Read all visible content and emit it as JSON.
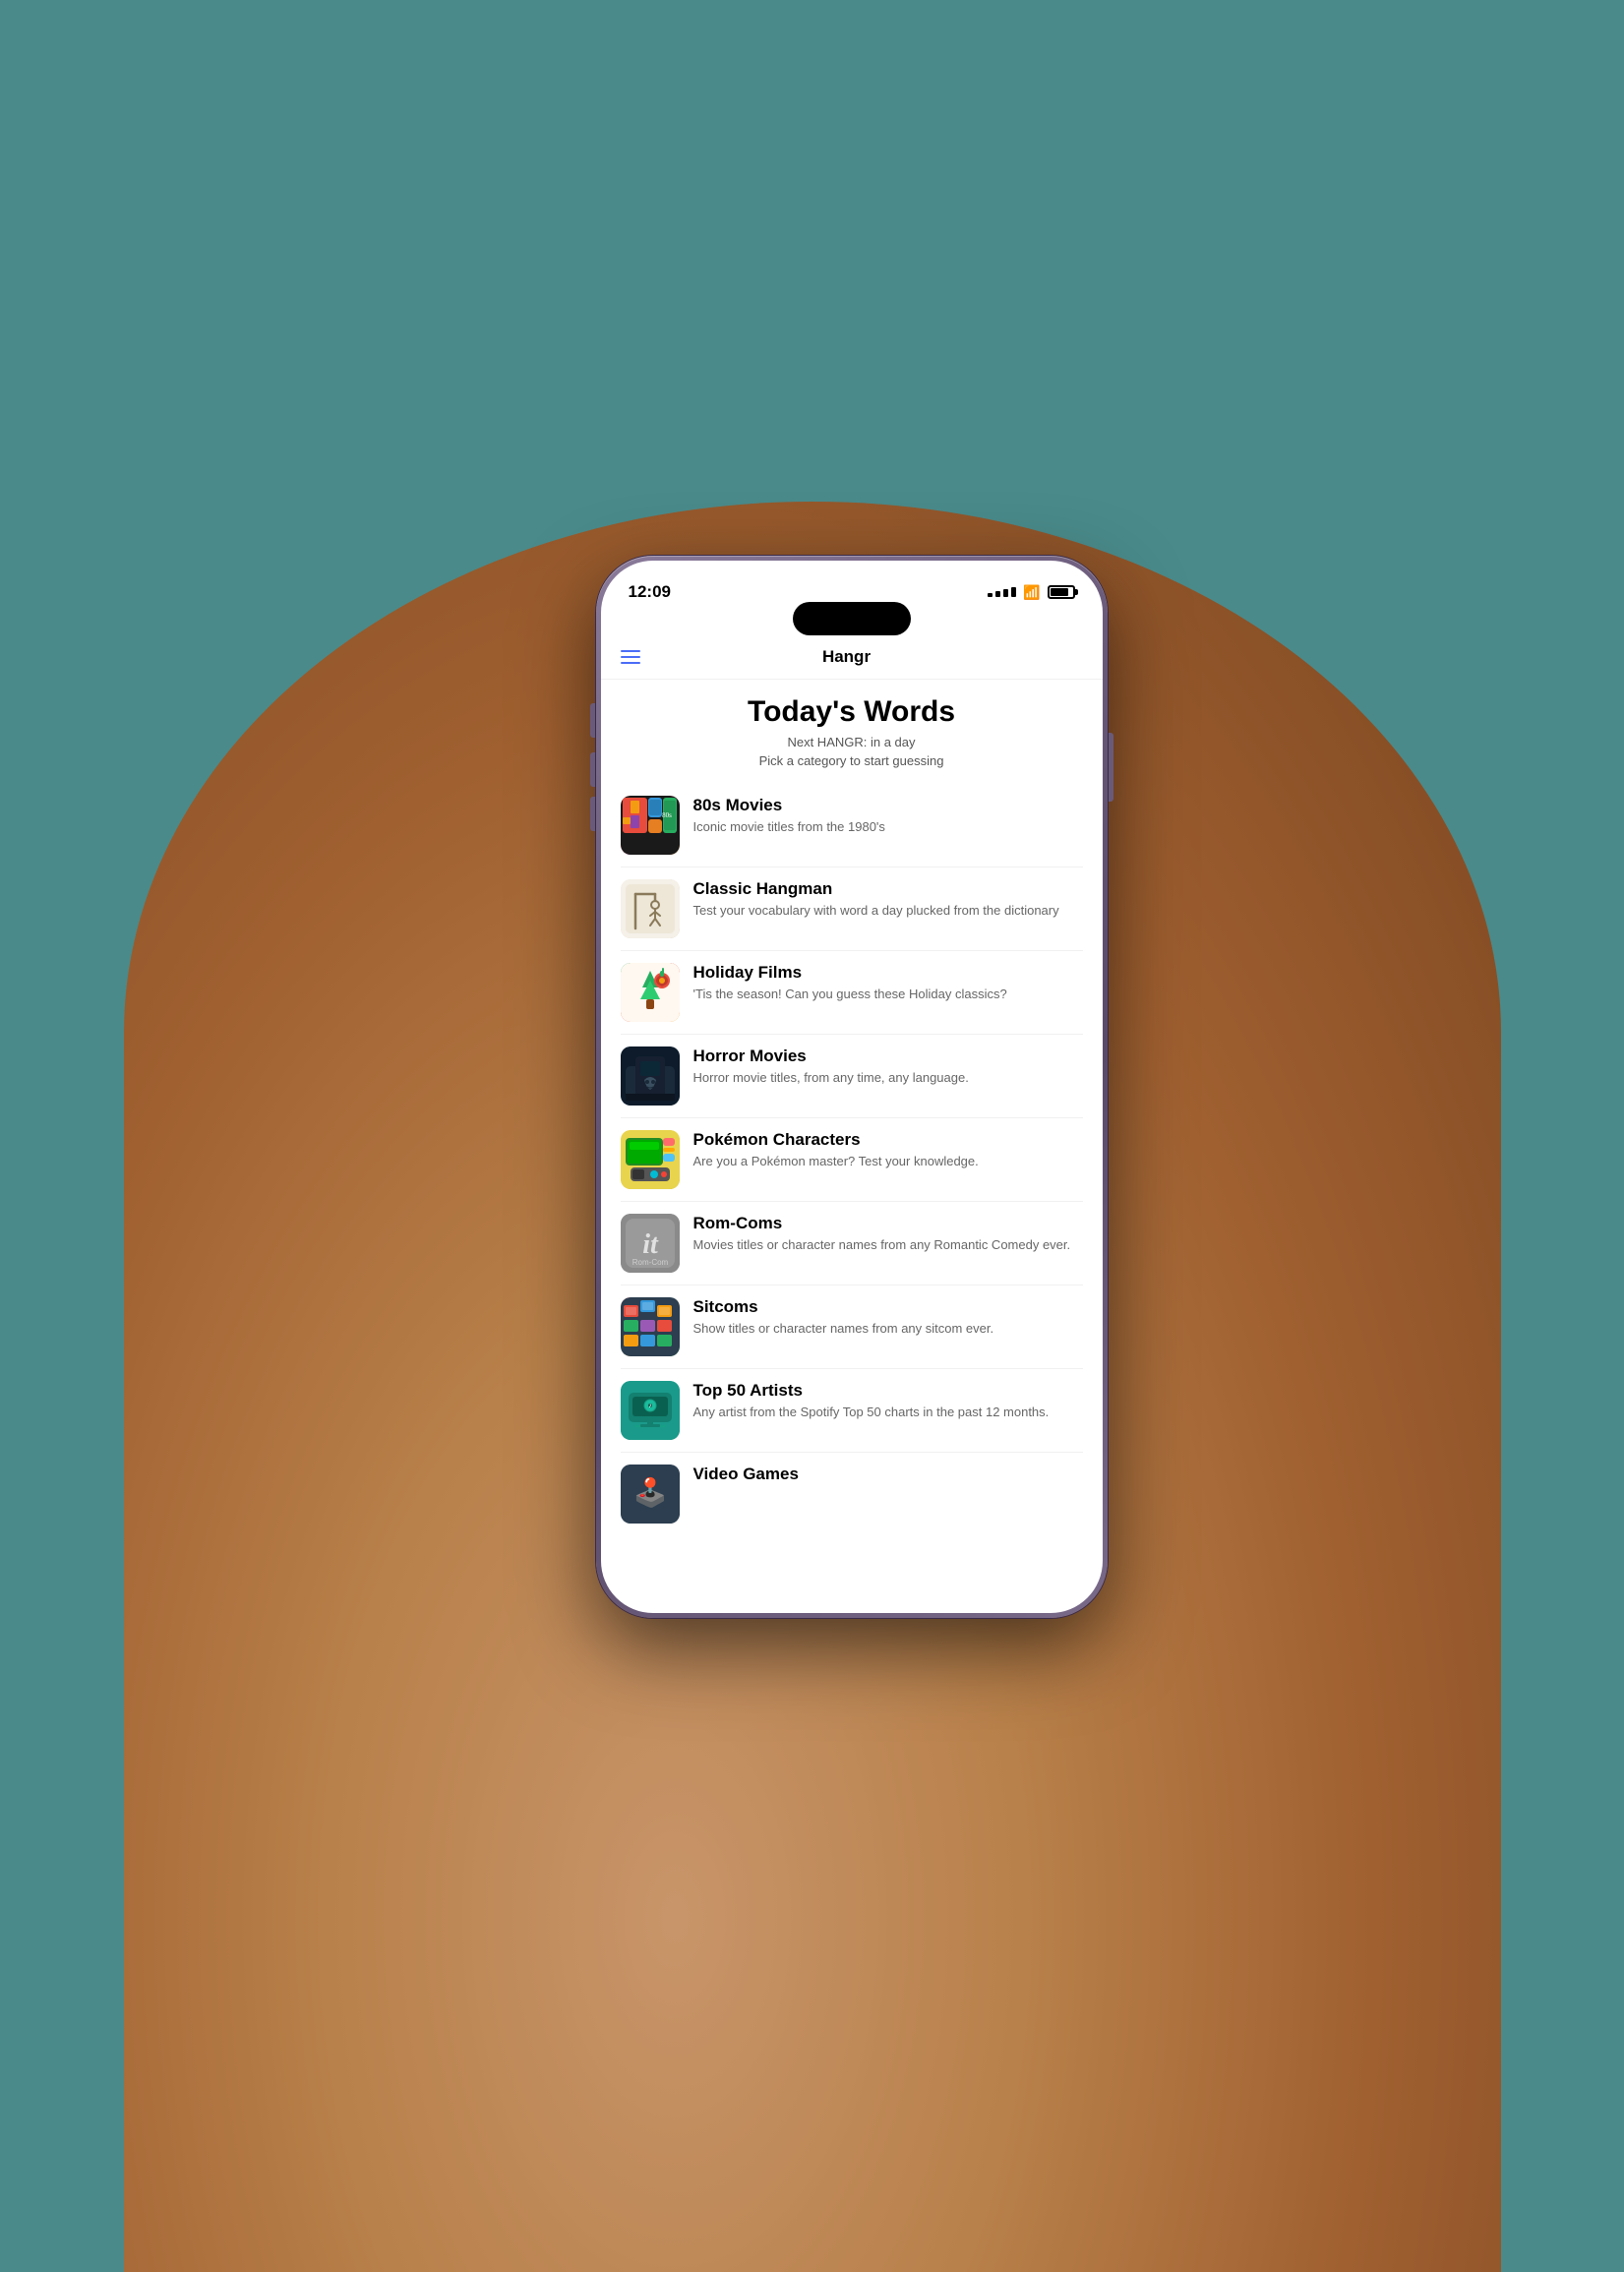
{
  "phone": {
    "time": "12:09",
    "app_title": "Hangr"
  },
  "page": {
    "title": "Today's Words",
    "next_hangr": "Next HANGR: in a day",
    "pick_category": "Pick a category to start guessing"
  },
  "categories": [
    {
      "id": "80s-movies",
      "name": "80s Movies",
      "description": "Iconic movie titles from the 1980's",
      "thumb_class": "thumb-80s",
      "emoji": "🎬"
    },
    {
      "id": "classic-hangman",
      "name": "Classic Hangman",
      "description": "Test your vocabulary with word a day plucked from the dictionary",
      "thumb_class": "thumb-classic",
      "emoji": "📖"
    },
    {
      "id": "holiday-films",
      "name": "Holiday Films",
      "description": "'Tis the season! Can you guess these Holiday classics?",
      "thumb_class": "thumb-holiday",
      "emoji": "🎄"
    },
    {
      "id": "horror-movies",
      "name": "Horror Movies",
      "description": "Horror movie titles, from any time, any language.",
      "thumb_class": "thumb-horror",
      "emoji": "👻"
    },
    {
      "id": "pokemon",
      "name": "Pokémon Characters",
      "description": "Are you a Pokémon master? Test your knowledge.",
      "thumb_class": "thumb-pokemon",
      "emoji": "🎮"
    },
    {
      "id": "rom-coms",
      "name": "Rom-Coms",
      "description": "Movies titles or character names from any Romantic Comedy ever.",
      "thumb_class": "thumb-romcoms",
      "emoji": "💝"
    },
    {
      "id": "sitcoms",
      "name": "Sitcoms",
      "description": "Show titles or character names from any sitcom ever.",
      "thumb_class": "thumb-sitcoms",
      "emoji": "📺"
    },
    {
      "id": "top50",
      "name": "Top 50 Artists",
      "description": "Any artist from the Spotify Top 50 charts in the past 12 months.",
      "thumb_class": "thumb-top50",
      "emoji": "🎵"
    },
    {
      "id": "video-games",
      "name": "Video Games",
      "description": "",
      "thumb_class": "thumb-videogames",
      "emoji": "🕹️"
    }
  ]
}
